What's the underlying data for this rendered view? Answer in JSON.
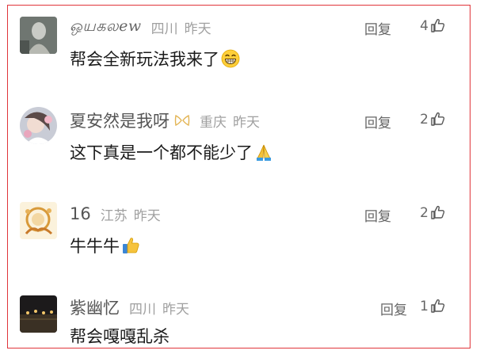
{
  "comments": [
    {
      "username": "ஒயகலew",
      "region": "四川",
      "time": "昨天",
      "reply_label": "回复",
      "likes": "4",
      "text": "帮会全新玩法我来了",
      "emoji": "grinning-face-emoji"
    },
    {
      "username": "夏安然是我呀",
      "badge": "bow-badge-icon",
      "region": "重庆",
      "time": "昨天",
      "reply_label": "回复",
      "likes": "2",
      "text": "这下真是一个都不能少了",
      "emoji": "folded-hands-emoji"
    },
    {
      "username": "16",
      "region": "江苏",
      "time": "昨天",
      "reply_label": "回复",
      "likes": "2",
      "text": "牛牛牛",
      "emoji": "thumbs-up-emoji"
    },
    {
      "username": "紫幽忆",
      "region": "四川",
      "time": "昨天",
      "reply_label": "回复",
      "likes": "1",
      "text": "帮会嘎嘎乱杀"
    }
  ],
  "colors": {
    "frame_border": "#e0343a",
    "username": "#555555",
    "meta": "#a0a0a0",
    "text": "#1a1a1a"
  }
}
